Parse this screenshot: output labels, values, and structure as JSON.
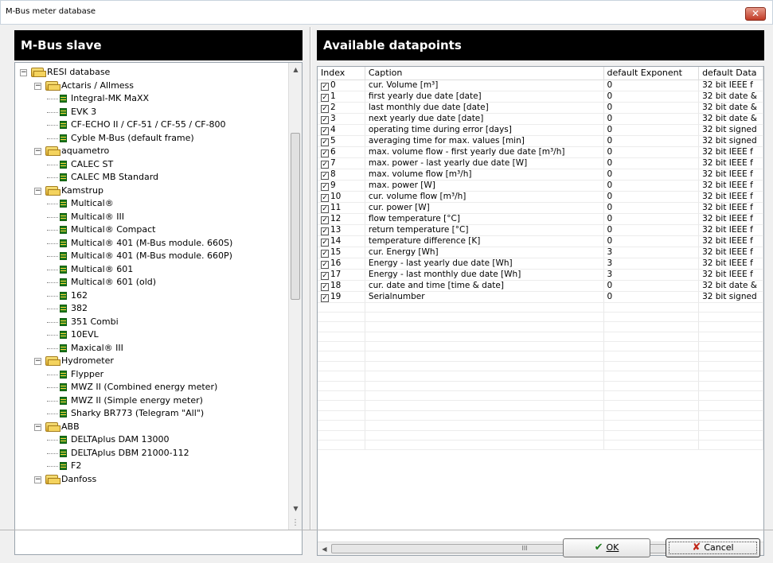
{
  "window": {
    "title": "M-Bus meter database",
    "close_glyph": "✕"
  },
  "left": {
    "header": "M-Bus slave",
    "tree": [
      {
        "label": "RESI database",
        "level": 0,
        "type": "folder",
        "expanded": true
      },
      {
        "label": "Actaris / Allmess",
        "level": 1,
        "type": "folder",
        "expanded": true
      },
      {
        "label": "Integral-MK MaXX",
        "level": 2,
        "type": "meter"
      },
      {
        "label": "EVK 3",
        "level": 2,
        "type": "meter"
      },
      {
        "label": "CF-ECHO II / CF-51 / CF-55 / CF-800",
        "level": 2,
        "type": "meter"
      },
      {
        "label": "Cyble M-Bus (default frame)",
        "level": 2,
        "type": "meter"
      },
      {
        "label": "aquametro",
        "level": 1,
        "type": "folder",
        "expanded": true
      },
      {
        "label": "CALEC ST",
        "level": 2,
        "type": "meter"
      },
      {
        "label": "CALEC MB Standard",
        "level": 2,
        "type": "meter"
      },
      {
        "label": "Kamstrup",
        "level": 1,
        "type": "folder",
        "expanded": true
      },
      {
        "label": "Multical®",
        "level": 2,
        "type": "meter"
      },
      {
        "label": "Multical® III",
        "level": 2,
        "type": "meter"
      },
      {
        "label": "Multical® Compact",
        "level": 2,
        "type": "meter"
      },
      {
        "label": "Multical® 401 (M-Bus module. 660S)",
        "level": 2,
        "type": "meter"
      },
      {
        "label": "Multical® 401 (M-Bus module. 660P)",
        "level": 2,
        "type": "meter"
      },
      {
        "label": "Multical® 601",
        "level": 2,
        "type": "meter"
      },
      {
        "label": "Multical® 601 (old)",
        "level": 2,
        "type": "meter"
      },
      {
        "label": "162",
        "level": 2,
        "type": "meter"
      },
      {
        "label": "382",
        "level": 2,
        "type": "meter"
      },
      {
        "label": "351 Combi",
        "level": 2,
        "type": "meter"
      },
      {
        "label": "10EVL",
        "level": 2,
        "type": "meter"
      },
      {
        "label": "Maxical® III",
        "level": 2,
        "type": "meter"
      },
      {
        "label": "Hydrometer",
        "level": 1,
        "type": "folder",
        "expanded": true
      },
      {
        "label": "Flypper",
        "level": 2,
        "type": "meter"
      },
      {
        "label": "MWZ II (Combined energy meter)",
        "level": 2,
        "type": "meter"
      },
      {
        "label": "MWZ II (Simple energy meter)",
        "level": 2,
        "type": "meter"
      },
      {
        "label": "Sharky BR773 (Telegram \"All\")",
        "level": 2,
        "type": "meter"
      },
      {
        "label": "ABB",
        "level": 1,
        "type": "folder",
        "expanded": true
      },
      {
        "label": "DELTAplus DAM 13000",
        "level": 2,
        "type": "meter"
      },
      {
        "label": "DELTAplus DBM 21000-112",
        "level": 2,
        "type": "meter"
      },
      {
        "label": "F2",
        "level": 2,
        "type": "meter"
      },
      {
        "label": "Danfoss",
        "level": 1,
        "type": "folder",
        "expanded": true
      }
    ]
  },
  "right": {
    "header": "Available datapoints",
    "columns": [
      "Index",
      "Caption",
      "default Exponent",
      "default Data"
    ],
    "rows": [
      {
        "index": "0",
        "caption": "cur. Volume [m³]",
        "exponent": "0",
        "data": "32 bit IEEE f"
      },
      {
        "index": "1",
        "caption": "first yearly due date [date]",
        "exponent": "0",
        "data": "32 bit date &"
      },
      {
        "index": "2",
        "caption": "last monthly due date [date]",
        "exponent": "0",
        "data": "32 bit date &"
      },
      {
        "index": "3",
        "caption": "next yearly due date [date]",
        "exponent": "0",
        "data": "32 bit date &"
      },
      {
        "index": "4",
        "caption": "operating time during error [days]",
        "exponent": "0",
        "data": "32 bit signed"
      },
      {
        "index": "5",
        "caption": "averaging time for max. values [min]",
        "exponent": "0",
        "data": "32 bit signed"
      },
      {
        "index": "6",
        "caption": "max. volume flow - first yearly due date [m³/h]",
        "exponent": "0",
        "data": "32 bit IEEE f"
      },
      {
        "index": "7",
        "caption": "max. power - last yearly due date [W]",
        "exponent": "0",
        "data": "32 bit IEEE f"
      },
      {
        "index": "8",
        "caption": "max. volume flow [m³/h]",
        "exponent": "0",
        "data": "32 bit IEEE f"
      },
      {
        "index": "9",
        "caption": "max. power [W]",
        "exponent": "0",
        "data": "32 bit IEEE f"
      },
      {
        "index": "10",
        "caption": "cur. volume flow [m³/h]",
        "exponent": "0",
        "data": "32 bit IEEE f"
      },
      {
        "index": "11",
        "caption": "cur. power [W]",
        "exponent": "0",
        "data": "32 bit IEEE f"
      },
      {
        "index": "12",
        "caption": "flow temperature  [°C]",
        "exponent": "0",
        "data": "32 bit IEEE f"
      },
      {
        "index": "13",
        "caption": "return temperature [°C]",
        "exponent": "0",
        "data": "32 bit IEEE f"
      },
      {
        "index": "14",
        "caption": "temperature difference [K]",
        "exponent": "0",
        "data": "32 bit IEEE f"
      },
      {
        "index": "15",
        "caption": "cur. Energy [Wh]",
        "exponent": "3",
        "data": "32 bit IEEE f"
      },
      {
        "index": "16",
        "caption": "Energy - last yearly due date [Wh]",
        "exponent": "3",
        "data": "32 bit IEEE f"
      },
      {
        "index": "17",
        "caption": "Energy - last monthly due date [Wh]",
        "exponent": "3",
        "data": "32 bit IEEE f"
      },
      {
        "index": "18",
        "caption": "cur. date and time [time & date]",
        "exponent": "0",
        "data": "32 bit date &"
      },
      {
        "index": "19",
        "caption": "Serialnumber",
        "exponent": "0",
        "data": "32 bit signed"
      }
    ],
    "empty_rows": 15,
    "scroll_thumb_text": "III"
  },
  "buttons": {
    "ok_label": "OK",
    "cancel_label": "Cancel",
    "ok_icon": "checkmark-icon",
    "cancel_icon": "cross-icon"
  }
}
